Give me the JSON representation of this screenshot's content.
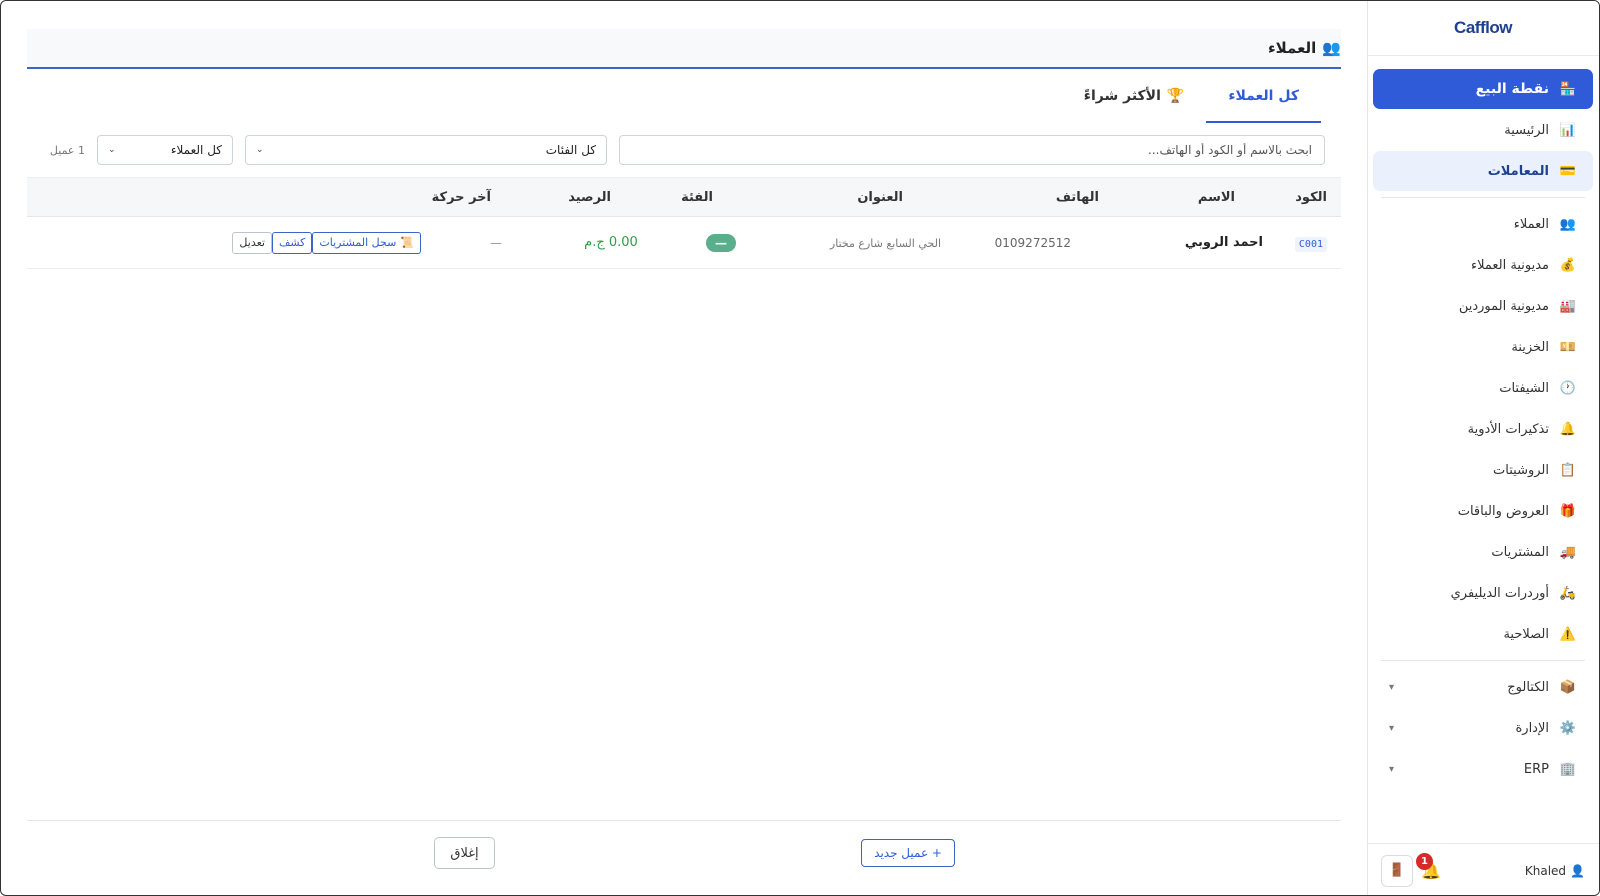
{
  "brand": "Cafflow",
  "sidebar": {
    "primary": {
      "icon": "🏪",
      "label": "نقطة البيع"
    },
    "top_items": [
      {
        "icon": "📊",
        "label": "الرئيسية"
      },
      {
        "icon": "💳",
        "label": "المعاملات"
      }
    ],
    "items": [
      {
        "icon": "👥",
        "label": "العملاء"
      },
      {
        "icon": "💰",
        "label": "مديونية العملاء"
      },
      {
        "icon": "🏭",
        "label": "مديونية الموردين"
      },
      {
        "icon": "💴",
        "label": "الخزينة"
      },
      {
        "icon": "🕐",
        "label": "الشيفتات"
      },
      {
        "icon": "🔔",
        "label": "تذكيرات الأدوية"
      },
      {
        "icon": "📋",
        "label": "الروشيتات"
      },
      {
        "icon": "🎁",
        "label": "العروض والباقات"
      },
      {
        "icon": "🚚",
        "label": "المشتريات"
      },
      {
        "icon": "🛵",
        "label": "أوردرات الديليفري"
      },
      {
        "icon": "⚠️",
        "label": "الصلاحية"
      }
    ],
    "groups": [
      {
        "icon": "📦",
        "label": "الكتالوج",
        "chevron": "▾"
      },
      {
        "icon": "⚙️",
        "label": "الإدارة",
        "chevron": "▾"
      },
      {
        "icon": "🏢",
        "label": "ERP",
        "chevron": "▾"
      }
    ],
    "footer": {
      "user_icon": "👤",
      "user": "Khaled",
      "bell_icon": "🔔",
      "notifications": "1",
      "logout_icon": "🚪"
    }
  },
  "header": {
    "icon": "👥",
    "title": "العملاء"
  },
  "tabs": [
    {
      "label": "كل العملاء",
      "icon": ""
    },
    {
      "label": "الأكثر شراءً",
      "icon": "🏆"
    }
  ],
  "filters": {
    "search_placeholder": "ابحث بالاسم أو الكود أو الهاتف...",
    "category": "كل الفئات",
    "customers": "كل العملاء",
    "count": "1 عميل",
    "caret": "⌄"
  },
  "table": {
    "headers": {
      "code": "الكود",
      "name": "الاسم",
      "phone": "الهاتف",
      "address": "العنوان",
      "category": "الفئة",
      "balance": "الرصيد",
      "last": "آخر حركة"
    },
    "rows": [
      {
        "code": "C001",
        "name": "احمد الروبي",
        "phone": "0109272512",
        "address": "الحي السابع شارع مختار",
        "category": "—",
        "balance": "0.00 ج.م",
        "last": "—",
        "actions": {
          "history_icon": "📜",
          "history": "سجل المشتريات",
          "statement": "كشف",
          "edit": "تعديل"
        }
      }
    ]
  },
  "footer": {
    "new_customer": "+ عميل جديد",
    "close": "إغلاق"
  }
}
